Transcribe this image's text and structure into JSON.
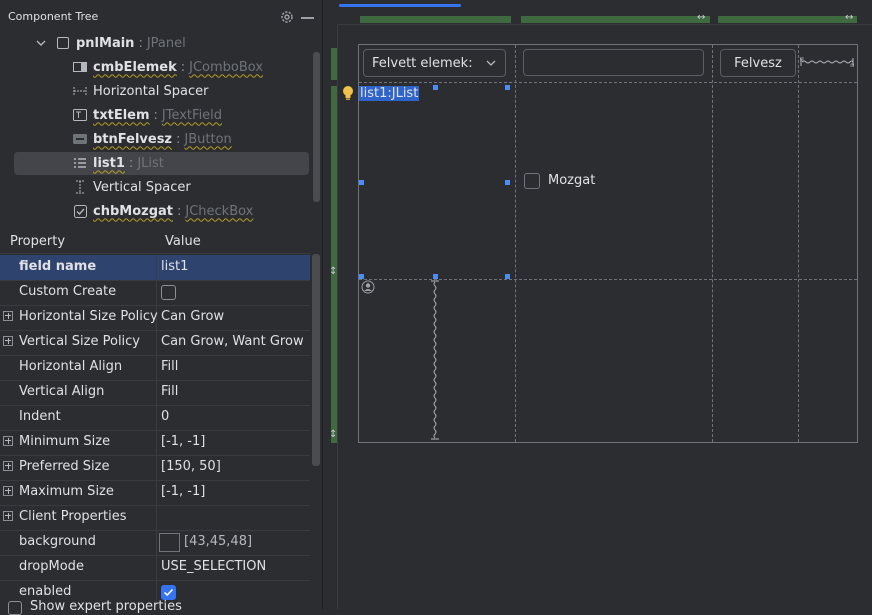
{
  "tree": {
    "title": "Component Tree",
    "items": [
      {
        "name": "pnlMain",
        "type": "JPanel",
        "icon": "panel-icon",
        "expanded": true
      },
      {
        "name": "cmbElemek",
        "type": "JComboBox",
        "icon": "combobox-icon"
      },
      {
        "name": "Horizontal Spacer",
        "icon": "horizontal-spacer-icon"
      },
      {
        "name": "txtElem",
        "type": "JTextField",
        "icon": "textfield-icon"
      },
      {
        "name": "btnFelvesz",
        "type": "JButton",
        "icon": "button-icon"
      },
      {
        "name": "list1",
        "type": "JList",
        "icon": "list-icon",
        "selected": true
      },
      {
        "name": "Vertical Spacer",
        "icon": "vertical-spacer-icon"
      },
      {
        "name": "chbMozgat",
        "type": "JCheckBox",
        "icon": "checkbox-icon"
      }
    ]
  },
  "properties": {
    "col_property": "Property",
    "col_value": "Value",
    "rows": [
      {
        "name": "field name",
        "value": "list1",
        "bold": true,
        "selected": true
      },
      {
        "name": "Custom Create",
        "checkbox": false
      },
      {
        "name": "Horizontal Size Policy",
        "value": "Can Grow",
        "expandable": true
      },
      {
        "name": "Vertical Size Policy",
        "value": "Can Grow, Want Grow",
        "expandable": true
      },
      {
        "name": "Horizontal Align",
        "value": "Fill"
      },
      {
        "name": "Vertical Align",
        "value": "Fill"
      },
      {
        "name": "Indent",
        "value": "0"
      },
      {
        "name": "Minimum Size",
        "value": "[-1, -1]",
        "expandable": true
      },
      {
        "name": "Preferred Size",
        "value": "[150, 50]",
        "expandable": true
      },
      {
        "name": "Maximum Size",
        "value": "[-1, -1]",
        "expandable": true
      },
      {
        "name": "Client Properties",
        "value": "",
        "expandable": true
      },
      {
        "name": "background",
        "value": "[43,45,48]",
        "color": "#2b2d30"
      },
      {
        "name": "dropMode",
        "value": "USE_SELECTION"
      },
      {
        "name": "enabled",
        "checkbox": true
      }
    ],
    "show_expert": "Show expert properties"
  },
  "form": {
    "combo_label": "Felvett elemek:",
    "textfield_value": "",
    "button_label": "Felvesz",
    "list_label": "list1:JList",
    "checkbox_label": "Mozgat"
  },
  "colors": {
    "accent": "#3574f0",
    "selection": "#2e436e",
    "grid_bar": "#3f6a3f"
  }
}
